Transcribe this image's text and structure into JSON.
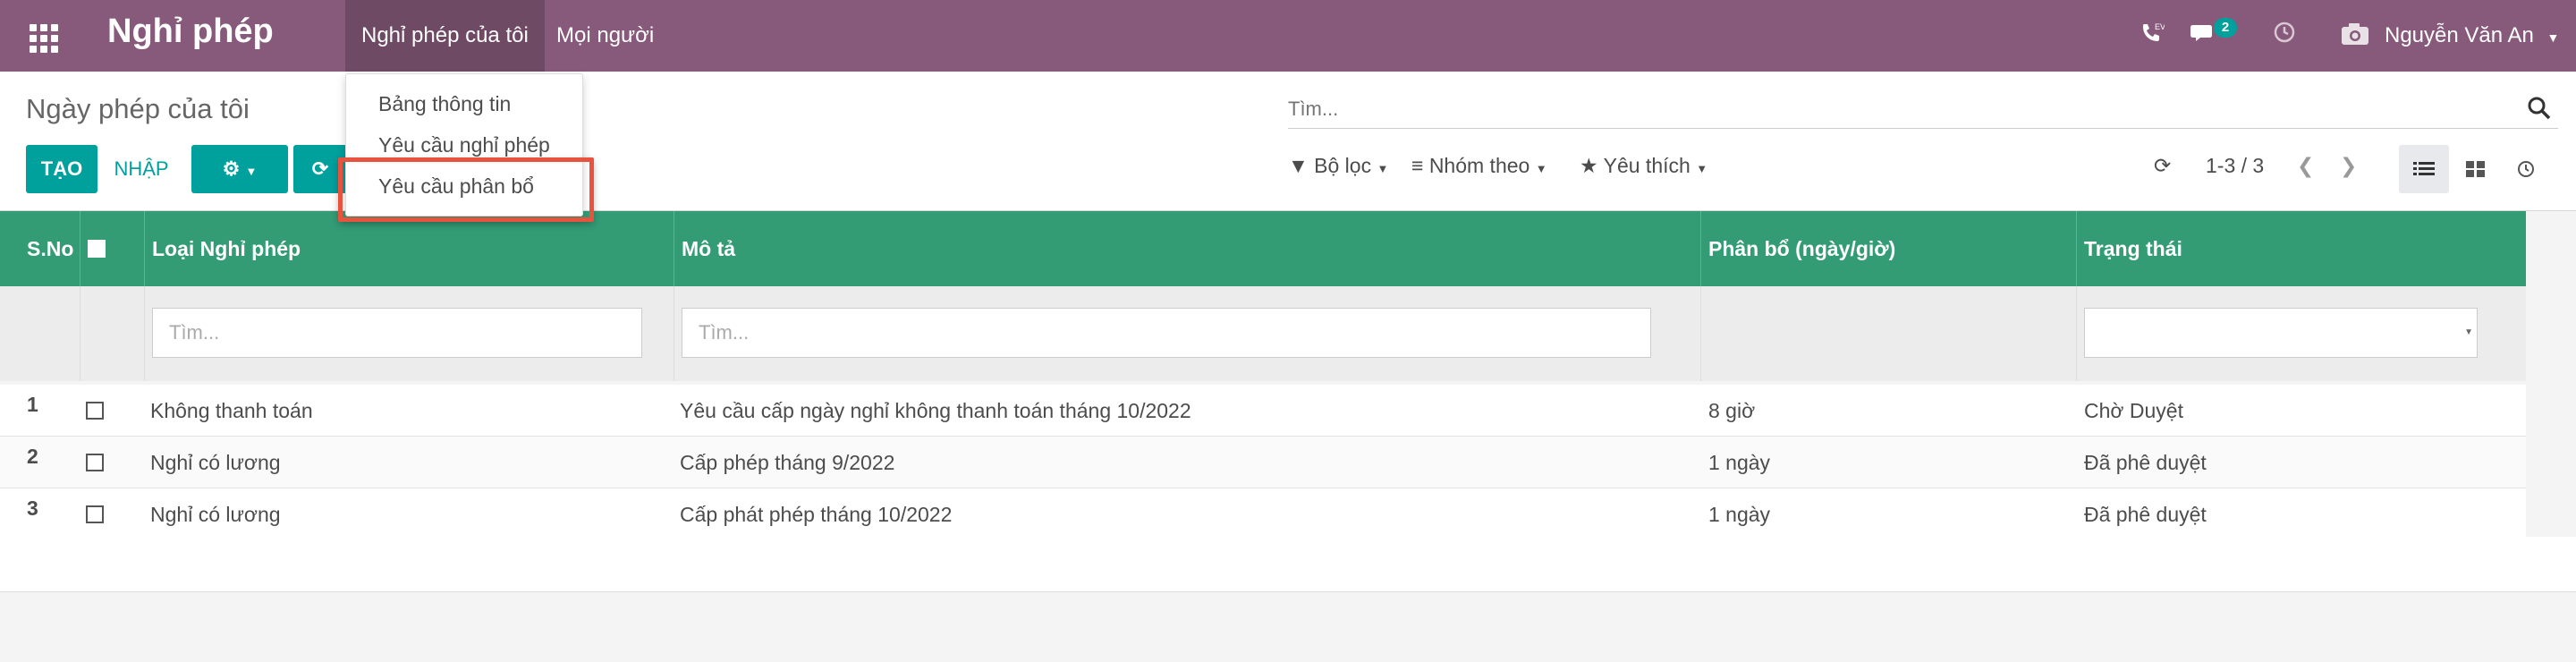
{
  "app": {
    "title": "Nghỉ phép"
  },
  "nav": {
    "menu": [
      {
        "label": "Nghỉ phép của tôi",
        "active": true
      },
      {
        "label": "Mọi người",
        "active": false
      }
    ],
    "chat_count": "2",
    "user": "Nguyễn Văn An",
    "phone_label": "EV"
  },
  "breadcrumb": "Ngày phép của tôi",
  "buttons": {
    "create": "TẠO",
    "import": "NHẬP"
  },
  "search": {
    "placeholder": "Tìm..."
  },
  "filters": {
    "filter": "Bộ lọc",
    "group": "Nhóm theo",
    "favorite": "Yêu thích"
  },
  "pager": "1-3 / 3",
  "dropdown": {
    "items": [
      "Bảng thông tin",
      "Yêu cầu nghỉ phép",
      "Yêu cầu phân bổ"
    ],
    "highlighted": "Yêu cầu phân bổ"
  },
  "table": {
    "headers": [
      "S.No",
      "Loại Nghỉ phép",
      "Mô tả",
      "Phân bổ (ngày/giờ)",
      "Trạng thái"
    ],
    "filter_placeholders": {
      "type": "Tìm...",
      "desc": "Tìm..."
    },
    "rows": [
      {
        "sno": "1",
        "type": "Không thanh toán",
        "desc": "Yêu cầu cấp ngày nghỉ không thanh toán tháng 10/2022",
        "alloc": "8 giờ",
        "status": "Chờ Duyệt"
      },
      {
        "sno": "2",
        "type": "Nghỉ có lương",
        "desc": "Cấp phép tháng 9/2022",
        "alloc": "1 ngày",
        "status": "Đã phê duyệt"
      },
      {
        "sno": "3",
        "type": "Nghỉ có lương",
        "desc": "Cấp phát phép tháng 10/2022",
        "alloc": "1 ngày",
        "status": "Đã phê duyệt"
      }
    ]
  },
  "colors": {
    "navbar": "#875a7b",
    "primary": "#00a09d",
    "table_header": "#339c75",
    "highlight": "#e8533f"
  }
}
